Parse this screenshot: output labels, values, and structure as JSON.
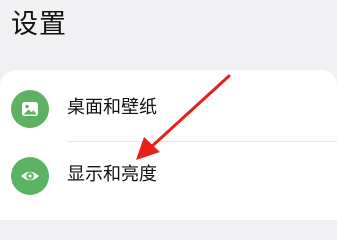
{
  "page": {
    "title": "设置"
  },
  "settings": {
    "items": [
      {
        "label": "桌面和壁纸",
        "icon": "wallpaper-image-icon"
      },
      {
        "label": "显示和亮度",
        "icon": "eye-icon"
      }
    ]
  },
  "colors": {
    "background": "#f1f1f3",
    "card": "#ffffff",
    "icon_green": "#5bb361",
    "annotation_red": "#e8201a"
  }
}
